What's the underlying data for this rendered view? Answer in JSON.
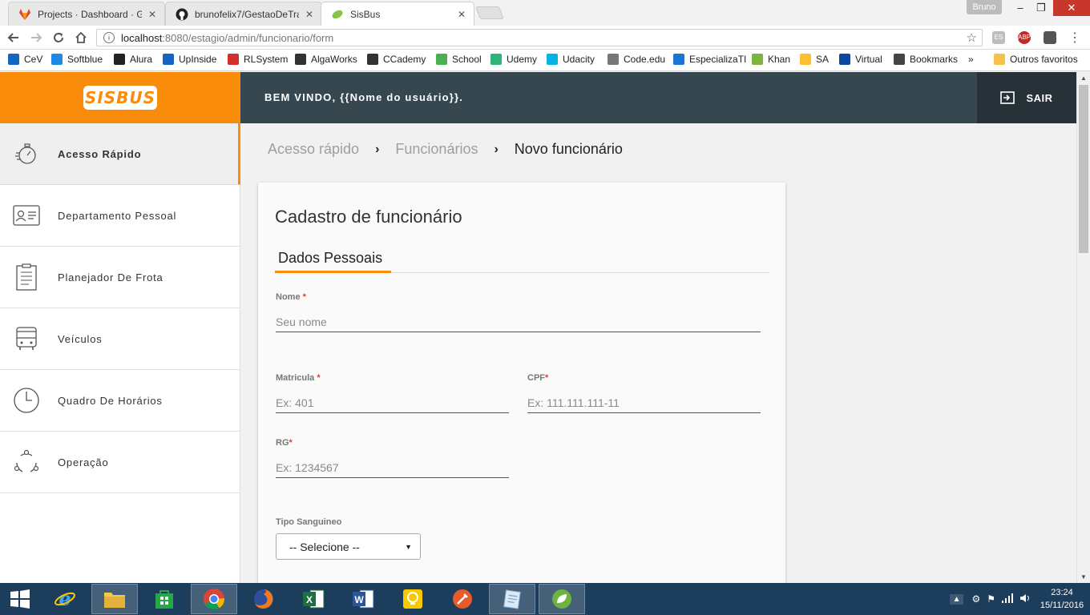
{
  "browser": {
    "tabs": [
      {
        "title": "Projects · Dashboard · Git",
        "icon": "gitlab-icon"
      },
      {
        "title": "brunofelix7/GestaoDeTra",
        "icon": "github-icon"
      },
      {
        "title": "SisBus",
        "icon": "leaf-icon"
      }
    ],
    "profile_name": "Bruno",
    "url_host": "localhost",
    "url_rest": ":8080/estagio/admin/funcionario/form",
    "extensions": [
      "ES",
      "ABP"
    ],
    "bookmarks": [
      {
        "label": "CeV",
        "color": "#1565c0"
      },
      {
        "label": "Softblue",
        "color": "#1e88e5"
      },
      {
        "label": "Alura",
        "color": "#222222"
      },
      {
        "label": "UpInside",
        "color": "#1565c0"
      },
      {
        "label": "RLSystem",
        "color": "#d32f2f"
      },
      {
        "label": "AlgaWorks",
        "color": "#333333"
      },
      {
        "label": "CCademy",
        "color": "#333333"
      },
      {
        "label": "School",
        "color": "#4caf50"
      },
      {
        "label": "Udemy",
        "color": "#2fb37a"
      },
      {
        "label": "Udacity",
        "color": "#02b3e4"
      },
      {
        "label": "Code.edu",
        "color": "#777777"
      },
      {
        "label": "EspecializaTI",
        "color": "#1976d2"
      },
      {
        "label": "Khan",
        "color": "#7cb342"
      },
      {
        "label": "SA",
        "color": "#fbc02d"
      },
      {
        "label": "Virtual",
        "color": "#0d47a1"
      },
      {
        "label": "Bookmarks",
        "color": "#444444"
      }
    ],
    "more_bookmarks": "»",
    "other_bookmarks": "Outros favoritos"
  },
  "app": {
    "logo_text": "SISBUS",
    "welcome": "BEM VINDO, {{Nome do usuário}}.",
    "logout_label": "SAIR",
    "accent_color": "#f98c0b",
    "header_color": "#37474f"
  },
  "sidebar": {
    "items": [
      {
        "label": "Acesso Rápido",
        "icon": "stopwatch-icon",
        "active": true
      },
      {
        "label": "Departamento Pessoal",
        "icon": "id-card-icon"
      },
      {
        "label": "Planejador De Frota",
        "icon": "clipboard-icon"
      },
      {
        "label": "Veículos",
        "icon": "bus-icon"
      },
      {
        "label": "Quadro De Horários",
        "icon": "clock-icon"
      },
      {
        "label": "Operação",
        "icon": "cycle-icon"
      }
    ]
  },
  "breadcrumb": [
    "Acesso rápido",
    "Funcionários",
    "Novo funcionário"
  ],
  "form": {
    "title": "Cadastro de funcionário",
    "tab": "Dados Pessoais",
    "required_mark": "*",
    "nome": {
      "label": "Nome",
      "placeholder": "Seu nome"
    },
    "matricula": {
      "label": "Matricula",
      "placeholder": "Ex: 401"
    },
    "cpf": {
      "label": "CPF",
      "placeholder": "Ex: 111.111.111-11"
    },
    "rg": {
      "label": "RG",
      "placeholder": "Ex: 1234567"
    },
    "tipo_sanguineo": {
      "label": "Tipo Sanguineo",
      "selected": "-- Selecione --"
    }
  },
  "taskbar": {
    "apps": [
      "windows-start-icon",
      "ie-icon",
      "file-explorer-icon",
      "store-icon",
      "chrome-icon",
      "firefox-icon",
      "excel-icon",
      "word-icon",
      "bulb-icon",
      "tool-icon",
      "notepad-icon",
      "spring-icon"
    ],
    "time": "23:24",
    "date": "15/11/2016"
  }
}
